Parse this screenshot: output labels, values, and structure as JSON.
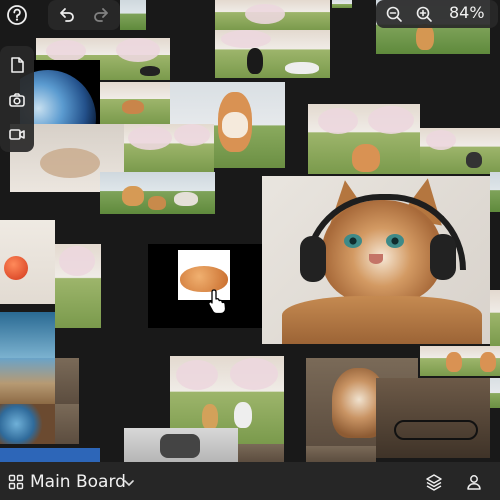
{
  "app": {
    "board_name": "Main Board",
    "zoom_label": "84%"
  },
  "toolbar_top_left": {
    "help_icon": "question-circle",
    "undo_icon": "undo-arrow",
    "redo_icon": "redo-arrow"
  },
  "toolbar_side": {
    "items": [
      {
        "name": "new-note",
        "icon": "file-icon"
      },
      {
        "name": "camera",
        "icon": "camera-icon"
      },
      {
        "name": "video",
        "icon": "video-icon"
      }
    ]
  },
  "toolbar_top_right": {
    "zoom_out_icon": "zoom-out-icon",
    "zoom_in_icon": "zoom-in-icon"
  },
  "bottom_bar": {
    "grid_icon": "grid-icon",
    "chevron_icon": "chevron-down-icon",
    "layers_icon": "layers-icon",
    "user_icon": "user-icon"
  }
}
